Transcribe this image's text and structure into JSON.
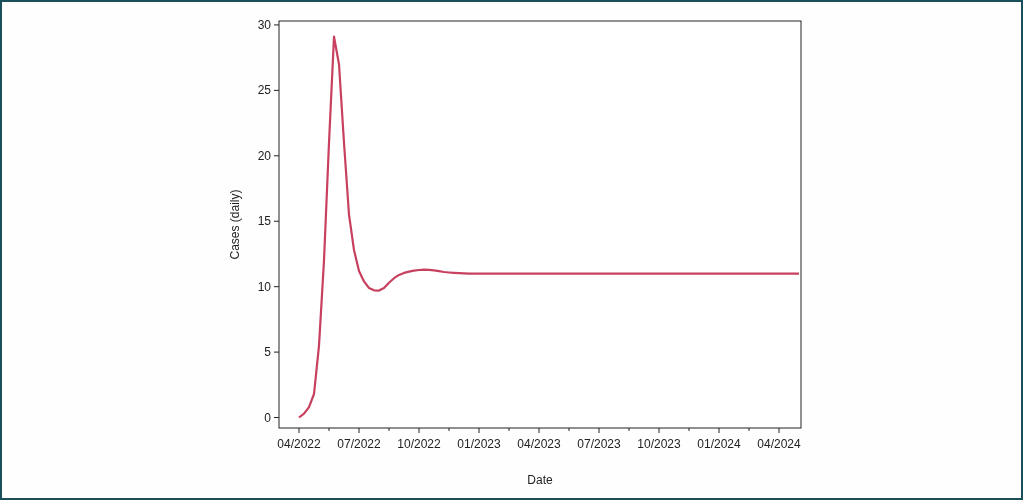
{
  "figure": {
    "chart_data": {
      "type": "line",
      "xlabel": "Date",
      "ylabel": "Cases (daily)",
      "ylim": [
        -0.8,
        30.3
      ],
      "categories": [
        "04/2022",
        null,
        null,
        null,
        null,
        null,
        null,
        null,
        null,
        null,
        null,
        null,
        "07/2022",
        null,
        null,
        null,
        null,
        null,
        null,
        null,
        null,
        null,
        null,
        null,
        "10/2022",
        null,
        null,
        null,
        null,
        null,
        null,
        null,
        null,
        null,
        null,
        null,
        "01/2023",
        null,
        null,
        null,
        null,
        null,
        null,
        null,
        null,
        null,
        null,
        null,
        "04/2023",
        null,
        null,
        null,
        null,
        null,
        null,
        null,
        null,
        null,
        null,
        null,
        "07/2023",
        null,
        null,
        null,
        null,
        null,
        null,
        null,
        null,
        null,
        null,
        null,
        "10/2023",
        null,
        null,
        null,
        null,
        null,
        null,
        null,
        null,
        null,
        null,
        null,
        "01/2024",
        null,
        null,
        null,
        null,
        null,
        null,
        null,
        null,
        null,
        null,
        null,
        "04/2024",
        null,
        null,
        null,
        null
      ],
      "yticks": [
        0,
        5,
        10,
        15,
        20,
        25,
        30
      ],
      "series": [
        {
          "color": "#c8405f",
          "values": [
            0,
            0.3,
            0.8,
            1.8,
            5.5,
            12,
            21,
            29.1,
            27,
            21,
            15.5,
            12.8,
            11.2,
            10.4,
            9.9,
            9.72,
            9.7,
            9.9,
            10.3,
            10.65,
            10.9,
            11.05,
            11.15,
            11.22,
            11.27,
            11.3,
            11.28,
            11.24,
            11.18,
            11.12,
            11.08,
            11.05,
            11.03,
            11.01,
            11,
            11,
            11,
            11,
            11,
            11,
            11,
            11,
            11,
            11,
            11,
            11,
            11,
            11,
            11,
            11,
            11,
            11,
            11,
            11,
            11,
            11,
            11,
            11,
            11,
            11,
            11,
            11,
            11,
            11,
            11,
            11,
            11,
            11,
            11,
            11,
            11,
            11,
            11,
            11,
            11,
            11,
            11,
            11,
            11,
            11,
            11,
            11,
            11,
            11,
            11,
            11,
            11,
            11,
            11,
            11,
            11,
            11,
            11,
            11,
            11,
            11,
            11,
            11,
            11,
            11,
            11
          ]
        }
      ]
    }
  }
}
